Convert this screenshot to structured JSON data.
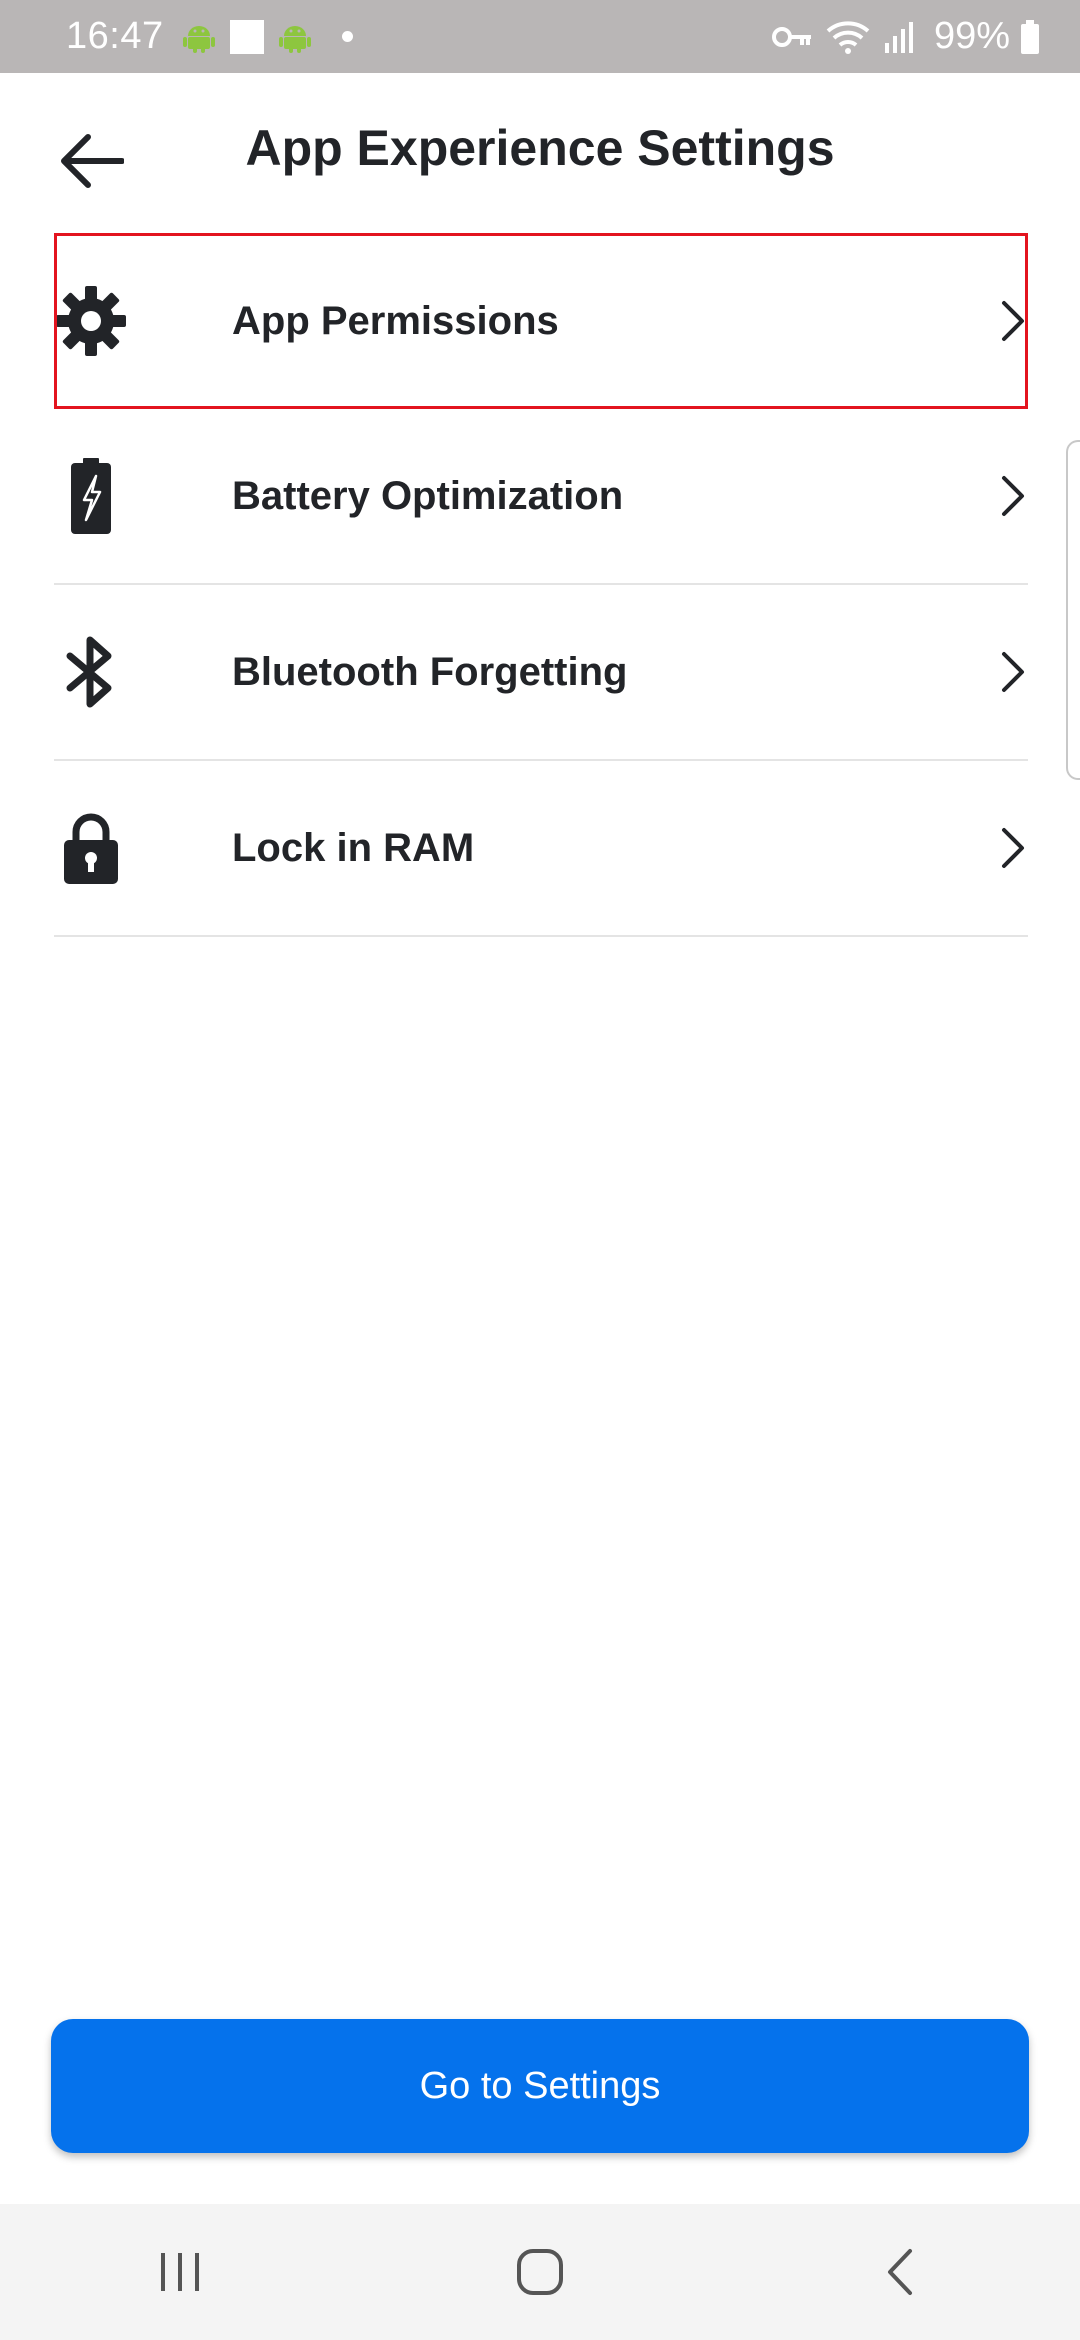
{
  "status_bar": {
    "time": "16:47",
    "battery_percent": "99%",
    "icons": [
      "android-icon",
      "white-square-icon",
      "android-icon",
      "dot-icon",
      "key-icon",
      "wifi-icon",
      "signal-icon",
      "battery-icon"
    ]
  },
  "header": {
    "title": "App Experience Settings",
    "back_icon": "arrow-left-icon"
  },
  "list": {
    "items": [
      {
        "label": "App Permissions",
        "icon": "gear-icon",
        "highlighted": true
      },
      {
        "label": "Battery Optimization",
        "icon": "battery-icon",
        "highlighted": false
      },
      {
        "label": "Bluetooth Forgetting",
        "icon": "bluetooth-icon",
        "highlighted": false
      },
      {
        "label": "Lock in RAM",
        "icon": "lock-icon",
        "highlighted": false
      }
    ]
  },
  "primary_button": {
    "label": "Go to Settings"
  },
  "nav_bar": {
    "buttons": [
      "recent-apps-icon",
      "home-icon",
      "back-icon"
    ]
  },
  "colors": {
    "accent": "#0572ec",
    "highlight_border": "#e3141f",
    "text": "#222428",
    "status_bar_bg": "#b9b6b6"
  }
}
